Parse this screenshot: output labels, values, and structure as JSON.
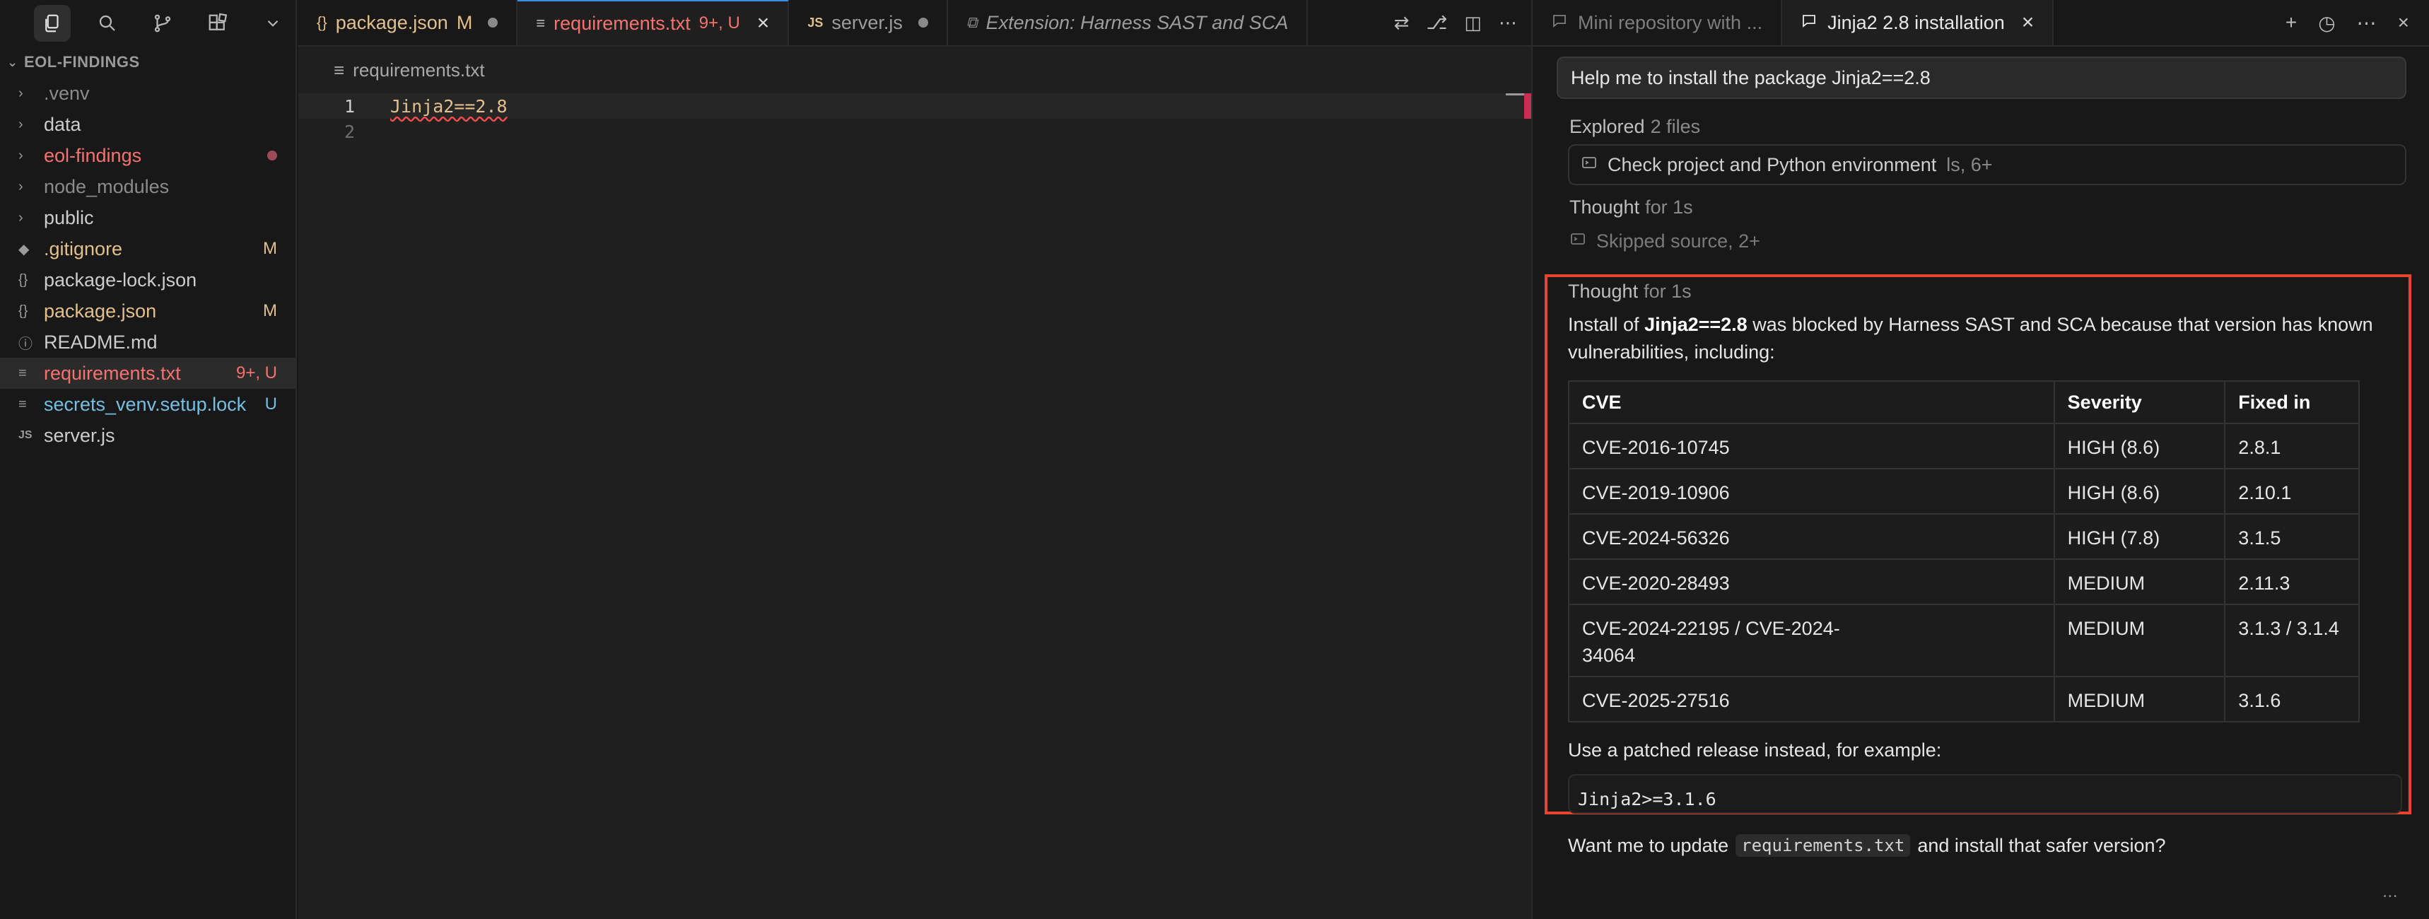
{
  "sidebar": {
    "tools": [
      "files-icon",
      "search-icon",
      "source-control-icon",
      "extensions-icon",
      "chevron-down-icon"
    ],
    "section_title": "EOL-FINDINGS",
    "items": [
      {
        "label": "data",
        "badge": ""
      },
      {
        "label": ".venv",
        "badge": ""
      },
      {
        "label": "eol-findings",
        "badge": ""
      },
      {
        "label": "node_modules",
        "badge": ""
      },
      {
        "label": "public",
        "badge": ""
      },
      {
        "label": ".gitignore",
        "badge": "M"
      },
      {
        "label": "package-lock.json",
        "badge": ""
      },
      {
        "label": "package.json",
        "badge": "M"
      },
      {
        "label": "README.md",
        "badge": ""
      },
      {
        "label": "requirements.txt",
        "badge": "9+, U"
      },
      {
        "label": "secrets_venv.setup.lock",
        "badge": "U"
      },
      {
        "label": "server.js",
        "badge": ""
      }
    ]
  },
  "editor": {
    "tabs": [
      {
        "label": "package.json",
        "badge": "M"
      },
      {
        "label": "requirements.txt",
        "badge": "9+, U"
      },
      {
        "label": "server.js",
        "badge": ""
      },
      {
        "label": "Extension: Harness SAST and SCA",
        "badge": ""
      }
    ],
    "breadcrumb": "requirements.txt",
    "lines": [
      {
        "number": "1",
        "text": "Jinja2==2.8"
      },
      {
        "number": "2",
        "text": ""
      }
    ]
  },
  "chat": {
    "tabs": [
      {
        "label": "Mini repository with ..."
      },
      {
        "label": "Jinja2 2.8 installation"
      }
    ],
    "user_message": "Help me to install the package Jinja2==2.8",
    "explored": {
      "label": "Explored",
      "detail": "2 files"
    },
    "tool_card": {
      "label": "Check project and Python environment",
      "detail": "ls, 6+"
    },
    "thought1": {
      "label": "Thought",
      "detail": "for 1s"
    },
    "skipped": "Skipped source, 2+",
    "thought2": {
      "label": "Thought",
      "detail": "for 1s"
    },
    "answer": {
      "intro_pre": "Install of ",
      "intro_bold": "Jinja2==2.8",
      "intro_post": " was blocked by Harness SAST and SCA because that version has known vulnerabilities, including:",
      "table_headers": [
        "CVE",
        "Severity",
        "Fixed in"
      ],
      "rows": [
        {
          "cve": "CVE-2016-10745",
          "severity": "HIGH (8.6)",
          "fixed": "2.8.1"
        },
        {
          "cve": "CVE-2019-10906",
          "severity": "HIGH (8.6)",
          "fixed": "2.10.1"
        },
        {
          "cve": "CVE-2024-56326",
          "severity": "HIGH (7.8)",
          "fixed": "3.1.5"
        },
        {
          "cve": "CVE-2020-28493",
          "severity": "MEDIUM",
          "fixed": "2.11.3"
        },
        {
          "cve": "CVE-2024-22195 / CVE-2024-34064",
          "severity": "MEDIUM",
          "fixed": "3.1.3 / 3.1.4"
        },
        {
          "cve": "CVE-2025-27516",
          "severity": "MEDIUM",
          "fixed": "3.1.6"
        }
      ],
      "suggestion": "Use a patched release instead, for example:",
      "code": "Jinja2>=3.1.6"
    },
    "followup_pre": "Want me to update",
    "followup_code": "requirements.txt",
    "followup_post": "and install that safer version?",
    "more": "..."
  },
  "colors": {
    "highlight": "#e8452c",
    "modified": "#e2c08d",
    "untracked": "#f7726e"
  }
}
